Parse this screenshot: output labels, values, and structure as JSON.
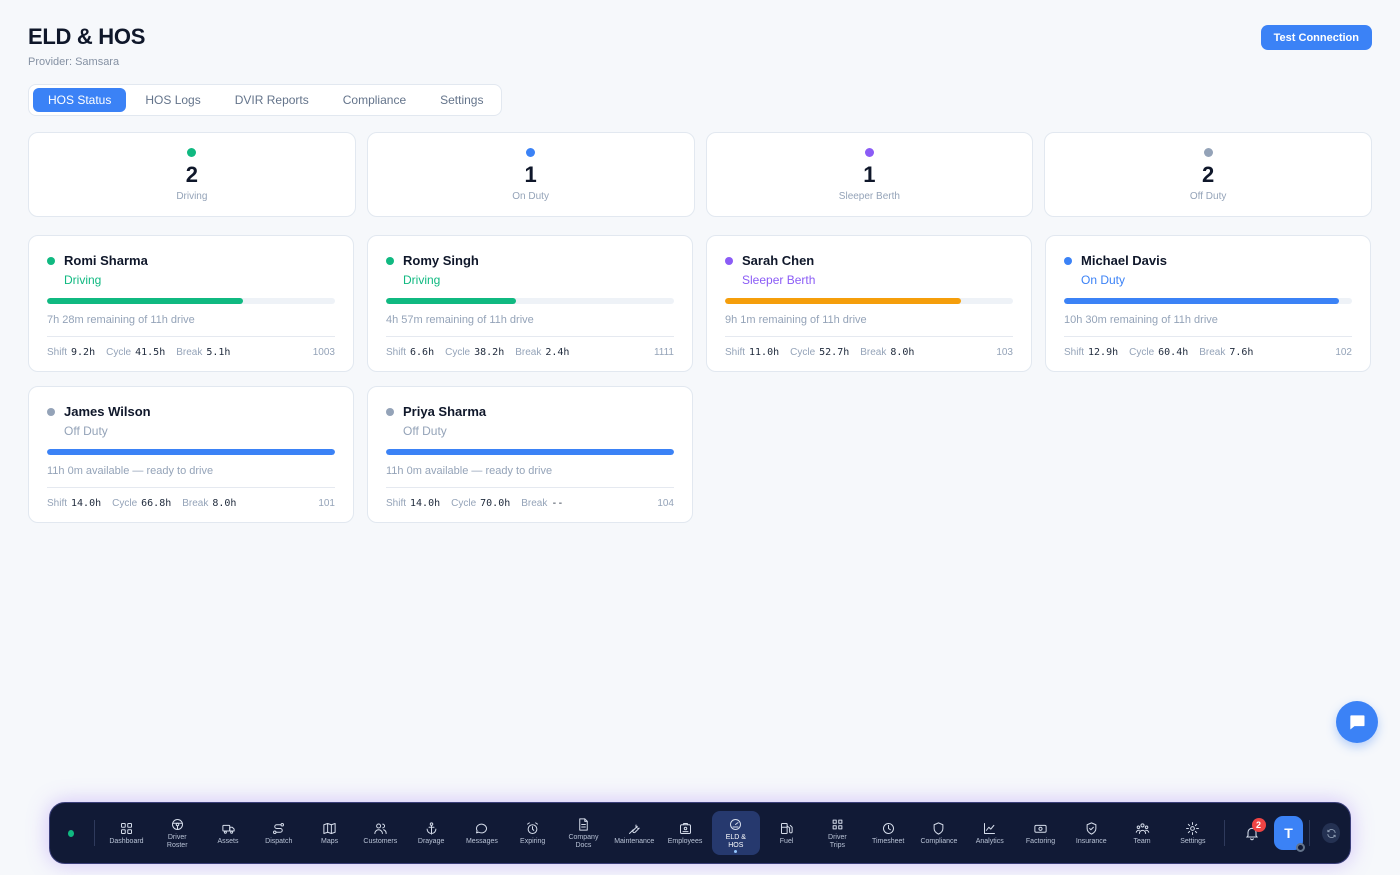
{
  "header": {
    "title": "ELD & HOS",
    "provider": "Provider: Samsara",
    "test_button": "Test Connection"
  },
  "tabs": [
    {
      "label": "HOS Status",
      "active": true
    },
    {
      "label": "HOS Logs",
      "active": false
    },
    {
      "label": "DVIR Reports",
      "active": false
    },
    {
      "label": "Compliance",
      "active": false
    },
    {
      "label": "Settings",
      "active": false
    }
  ],
  "stats": [
    {
      "value": "2",
      "label": "Driving",
      "color": "#10b981"
    },
    {
      "value": "1",
      "label": "On Duty",
      "color": "#3b82f6"
    },
    {
      "value": "1",
      "label": "Sleeper Berth",
      "color": "#8b5cf6"
    },
    {
      "value": "2",
      "label": "Off Duty",
      "color": "#94a3b8"
    }
  ],
  "labels": {
    "shift": "Shift",
    "cycle": "Cycle",
    "break": "Break"
  },
  "drivers": [
    {
      "name": "Romi Sharma",
      "status": "Driving",
      "status_color": "#10b981",
      "dot_color": "#10b981",
      "bar_color": "#10b981",
      "progress": 0.68,
      "remaining": "7h 28m remaining of 11h drive",
      "shift": "9.2h",
      "cycle": "41.5h",
      "break": "5.1h",
      "unit": "1003"
    },
    {
      "name": "Romy Singh",
      "status": "Driving",
      "status_color": "#10b981",
      "dot_color": "#10b981",
      "bar_color": "#10b981",
      "progress": 0.45,
      "remaining": "4h 57m remaining of 11h drive",
      "shift": "6.6h",
      "cycle": "38.2h",
      "break": "2.4h",
      "unit": "1111"
    },
    {
      "name": "Sarah Chen",
      "status": "Sleeper Berth",
      "status_color": "#8b5cf6",
      "dot_color": "#8b5cf6",
      "bar_color": "#f59e0b",
      "progress": 0.82,
      "remaining": "9h 1m remaining of 11h drive",
      "shift": "11.0h",
      "cycle": "52.7h",
      "break": "8.0h",
      "unit": "103"
    },
    {
      "name": "Michael Davis",
      "status": "On Duty",
      "status_color": "#3b82f6",
      "dot_color": "#3b82f6",
      "bar_color": "#3b82f6",
      "progress": 0.955,
      "remaining": "10h 30m remaining of 11h drive",
      "shift": "12.9h",
      "cycle": "60.4h",
      "break": "7.6h",
      "unit": "102"
    },
    {
      "name": "James Wilson",
      "status": "Off Duty",
      "status_color": "#94a3b8",
      "dot_color": "#94a3b8",
      "bar_color": "#3b82f6",
      "progress": 1.0,
      "remaining": "11h 0m available — ready to drive",
      "shift": "14.0h",
      "cycle": "66.8h",
      "break": "8.0h",
      "unit": "101"
    },
    {
      "name": "Priya Sharma",
      "status": "Off Duty",
      "status_color": "#94a3b8",
      "dot_color": "#94a3b8",
      "bar_color": "#3b82f6",
      "progress": 1.0,
      "remaining": "11h 0m available — ready to drive",
      "shift": "14.0h",
      "cycle": "70.0h",
      "break": "--",
      "unit": "104"
    }
  ],
  "dock": {
    "items": [
      {
        "label": "Dashboard",
        "icon": "grid-icon"
      },
      {
        "label": "Driver\nRoster",
        "icon": "steering-wheel-icon"
      },
      {
        "label": "Assets",
        "icon": "truck-icon"
      },
      {
        "label": "Dispatch",
        "icon": "route-icon"
      },
      {
        "label": "Maps",
        "icon": "map-icon"
      },
      {
        "label": "Customers",
        "icon": "users-icon"
      },
      {
        "label": "Drayage",
        "icon": "anchor-icon"
      },
      {
        "label": "Messages",
        "icon": "message-icon"
      },
      {
        "label": "Expiring",
        "icon": "alarm-clock-icon"
      },
      {
        "label": "Company\nDocs",
        "icon": "document-icon"
      },
      {
        "label": "Maintenance",
        "icon": "wrench-icon"
      },
      {
        "label": "Employees",
        "icon": "id-badge-icon"
      },
      {
        "label": "ELD &\nHOS",
        "icon": "gauge-icon",
        "active": true
      },
      {
        "label": "Fuel",
        "icon": "fuel-pump-icon"
      },
      {
        "label": "Driver\nTrips",
        "icon": "apps-icon"
      },
      {
        "label": "Timesheet",
        "icon": "clock-icon"
      },
      {
        "label": "Compliance",
        "icon": "shield-icon"
      },
      {
        "label": "Analytics",
        "icon": "chart-line-icon"
      },
      {
        "label": "Factoring",
        "icon": "banknote-icon"
      },
      {
        "label": "Insurance",
        "icon": "shield-check-icon"
      },
      {
        "label": "Team",
        "icon": "team-icon"
      },
      {
        "label": "Settings",
        "icon": "gear-icon"
      }
    ],
    "notification_count": "2",
    "avatar_initial": "T"
  }
}
